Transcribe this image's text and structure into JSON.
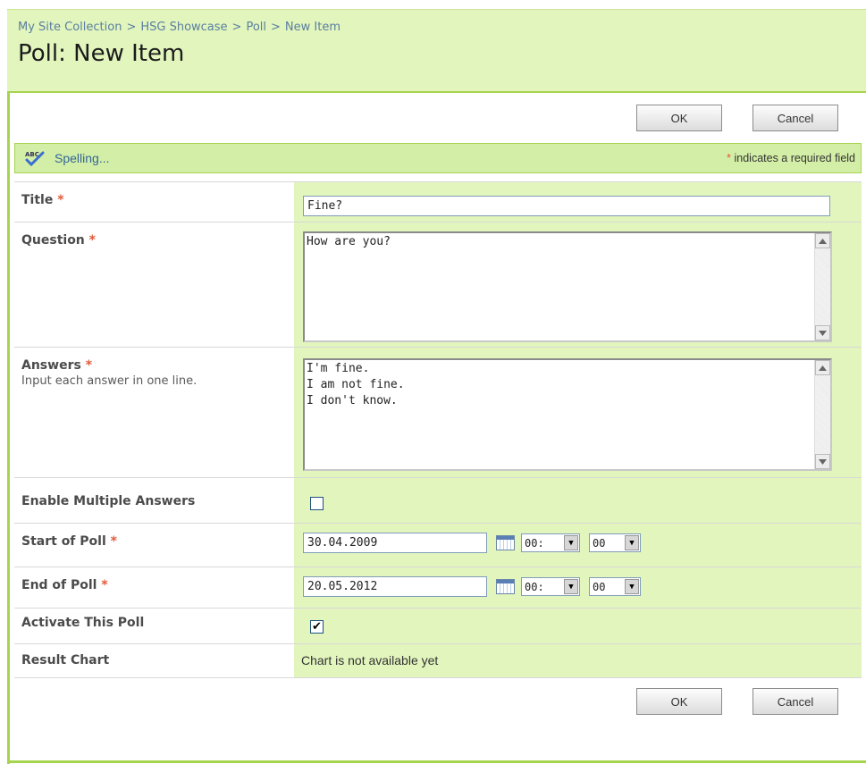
{
  "breadcrumb": {
    "items": [
      "My Site Collection",
      "HSG Showcase",
      "Poll",
      "New Item"
    ],
    "separator": ">"
  },
  "page_title": "Poll: New Item",
  "buttons": {
    "ok": "OK",
    "cancel": "Cancel"
  },
  "toolbar": {
    "spelling_label": "Spelling...",
    "spelling_icon": "spellcheck-icon",
    "required_marker": "*",
    "required_note": "indicates a required field"
  },
  "fields": {
    "title": {
      "label": "Title",
      "required": "*",
      "value": "Fine?"
    },
    "question": {
      "label": "Question",
      "required": "*",
      "value": "How are you?"
    },
    "answers": {
      "label": "Answers",
      "required": "*",
      "description": "Input each answer in one line.",
      "lines": [
        "I'm fine.",
        "I am not fine.",
        "I don't know."
      ]
    },
    "multiple_answers": {
      "label": "Enable Multiple Answers",
      "checked": false,
      "mark": ""
    },
    "start": {
      "label": "Start of Poll",
      "required": "*",
      "date": "30.04.2009",
      "hour": "00:",
      "minute": "00"
    },
    "end": {
      "label": "End of Poll",
      "required": "*",
      "date": "20.05.2012",
      "hour": "00:",
      "minute": "00"
    },
    "activate": {
      "label": "Activate This Poll",
      "checked": true,
      "mark": "✔"
    },
    "result_chart": {
      "label": "Result Chart",
      "value": "Chart is not available yet"
    }
  },
  "colors": {
    "header_bg": "#e2f5bd",
    "accent_border": "#a7d44f",
    "toolbar_bg": "#d3eea6",
    "link": "#336699",
    "required": "#e05a3a"
  }
}
